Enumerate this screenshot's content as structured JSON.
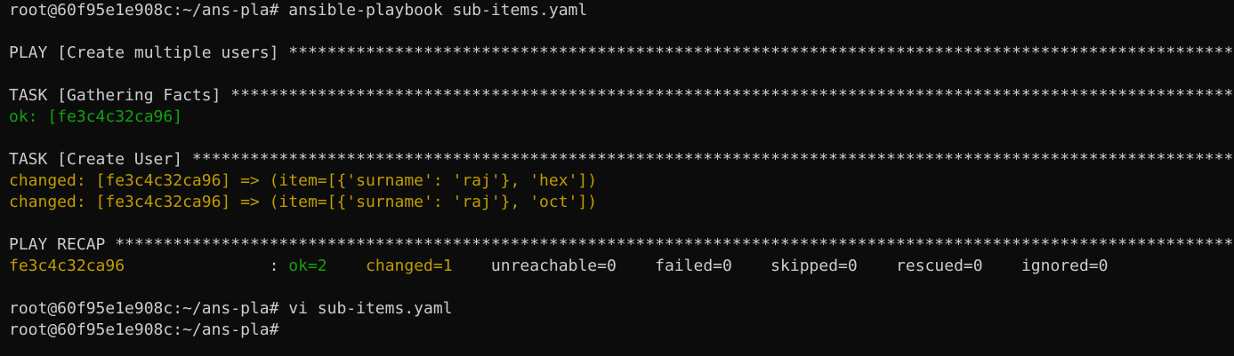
{
  "terminal": {
    "colors": {
      "background": "#0c0c0c",
      "default_text": "#cccccc",
      "ok_green": "#13a10e",
      "changed_yellow": "#c19c00"
    },
    "lines": {
      "l1": "root@60f95e1e908c:~/ans-pla# ansible-playbook sub-items.yaml",
      "l2": "",
      "l3": "PLAY [Create multiple users] ****************************************************************************************************",
      "l4": "",
      "l5": "TASK [Gathering Facts] **********************************************************************************************************",
      "l6": "ok: [fe3c4c32ca96]",
      "l7": "",
      "l8": "TASK [Create User] **************************************************************************************************************",
      "l9": "changed: [fe3c4c32ca96] => (item=[{'surname': 'raj'}, 'hex'])",
      "l10": "changed: [fe3c4c32ca96] => (item=[{'surname': 'raj'}, 'oct'])",
      "l11": "",
      "l12": "PLAY RECAP **********************************************************************************************************************",
      "l13": {
        "host": "fe3c4c32ca96               ",
        "sep": ": ",
        "ok": "ok=2",
        "gap1": "    ",
        "changed": "changed=1",
        "rest": "    unreachable=0    failed=0    skipped=0    rescued=0    ignored=0"
      },
      "l14": "",
      "l15": "root@60f95e1e908c:~/ans-pla# vi sub-items.yaml",
      "l16": "root@60f95e1e908c:~/ans-pla# "
    }
  }
}
